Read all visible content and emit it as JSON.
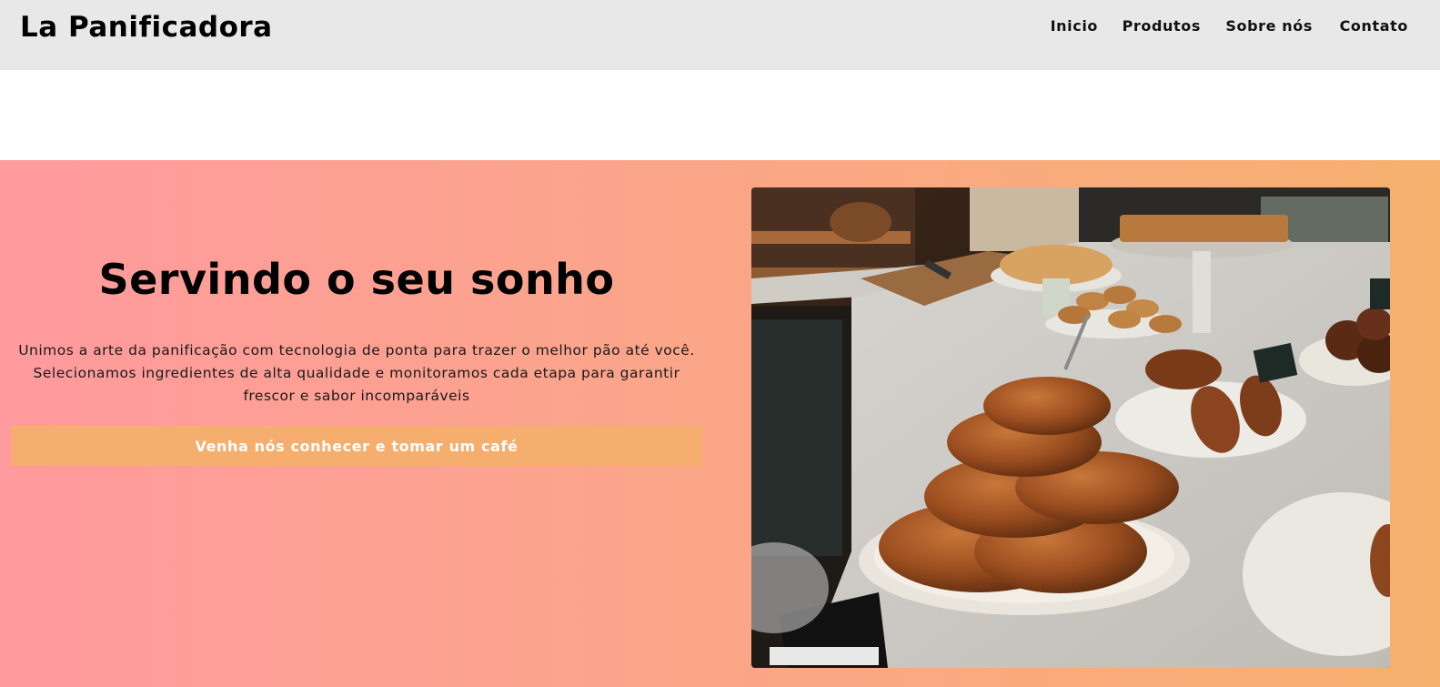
{
  "header": {
    "brand": "La Panificadora",
    "nav": [
      {
        "label": "Inicio"
      },
      {
        "label": "Produtos"
      },
      {
        "label": "Sobre nós"
      },
      {
        "label": "Contato"
      }
    ]
  },
  "hero": {
    "title": "Servindo o seu sonho",
    "text": "Unimos a arte da panificação com tecnologia de ponta para trazer o melhor pão até você. Selecionamos ingredientes de alta qualidade e monitoramos cada etapa para garantir frescor e sabor incomparáveis",
    "button_label": "Venha nós conhecer e tomar um café",
    "image_alt": "pastries-photo"
  },
  "colors": {
    "navbar_bg": "#e8e8e8",
    "gradient_start": "#ff9a9e",
    "gradient_end": "#f7b06e",
    "button_bg": "#f5ae6e",
    "button_text": "#ffffff"
  }
}
